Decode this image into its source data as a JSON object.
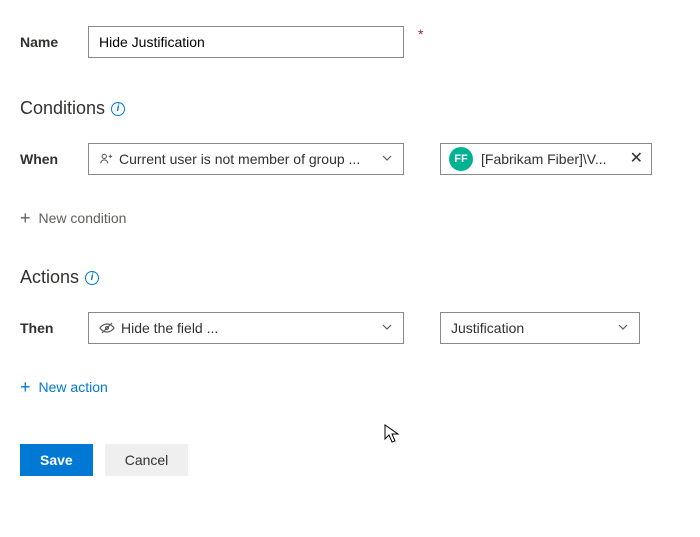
{
  "name": {
    "label": "Name",
    "value": "Hide Justification"
  },
  "conditions": {
    "heading": "Conditions",
    "when_label": "When",
    "when_dropdown": "Current user is not member of group ...",
    "group_chip": {
      "initials": "FF",
      "text": "[Fabrikam Fiber]\\V..."
    },
    "new_condition": "New condition"
  },
  "actions": {
    "heading": "Actions",
    "then_label": "Then",
    "then_dropdown": "Hide the field ...",
    "field_dropdown": "Justification",
    "new_action": "New action"
  },
  "buttons": {
    "save": "Save",
    "cancel": "Cancel"
  }
}
